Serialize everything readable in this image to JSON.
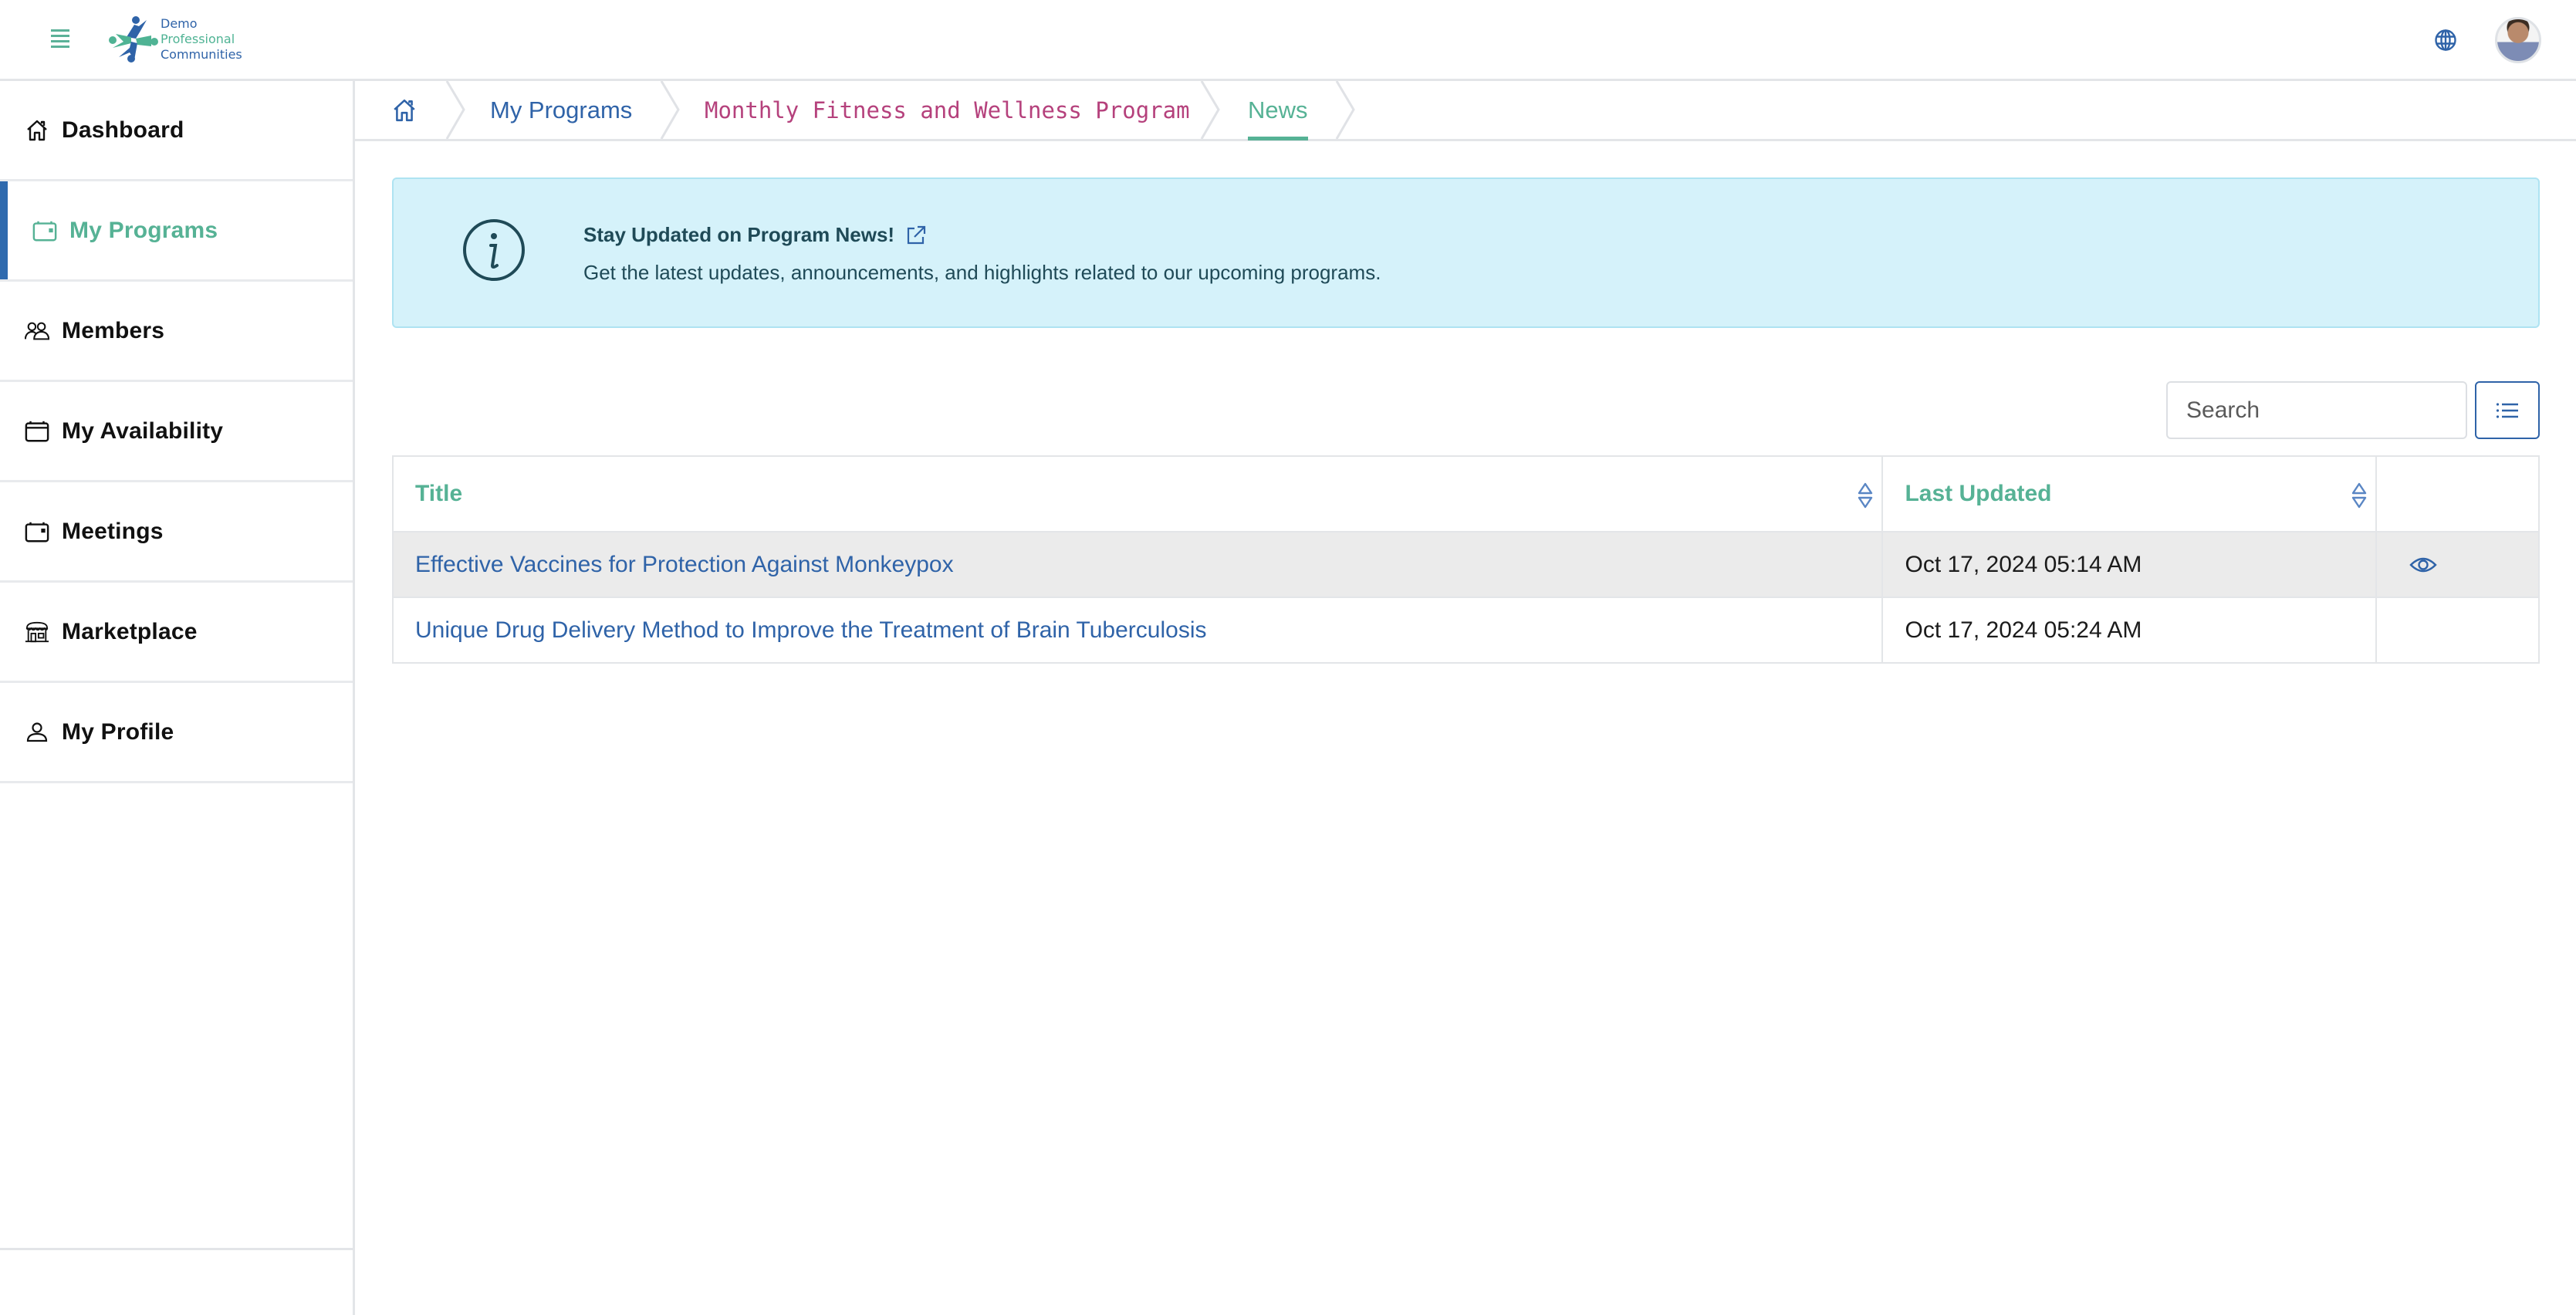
{
  "header": {
    "menu_icon": "hamburger-menu-icon",
    "logo": {
      "line1": "Demo",
      "line2": "Professional",
      "line3": "Communities"
    },
    "language_icon": "globe-icon",
    "avatar": "user-avatar"
  },
  "sidebar": {
    "active": "My Programs",
    "items": [
      {
        "label": "Dashboard",
        "icon": "home-icon"
      },
      {
        "label": "My Programs",
        "icon": "calendar-icon"
      },
      {
        "label": "Members",
        "icon": "members-icon"
      },
      {
        "label": "My Availability",
        "icon": "calendar-blank-icon"
      },
      {
        "label": "Meetings",
        "icon": "calendar-icon"
      },
      {
        "label": "Marketplace",
        "icon": "store-icon"
      },
      {
        "label": "My Profile",
        "icon": "user-icon"
      }
    ]
  },
  "breadcrumb": {
    "home_icon": "home-icon",
    "items": [
      {
        "label": "My Programs"
      },
      {
        "label": "Monthly Fitness and Wellness Program"
      },
      {
        "label": "News"
      }
    ],
    "collapse_icon": "chevron-left-icon"
  },
  "alert": {
    "title": "Stay Updated on Program News!",
    "body": "Get the latest updates, announcements, and highlights related to our upcoming programs.",
    "icon": "info-icon",
    "link_icon": "external-link-icon"
  },
  "toolbar": {
    "search_placeholder": "Search",
    "search_value": "",
    "view_toggle_icon": "list-icon"
  },
  "table": {
    "columns": [
      {
        "label": "Title",
        "sortable": true
      },
      {
        "label": "Last Updated",
        "sortable": true
      },
      {
        "label": "",
        "sortable": false
      }
    ],
    "rows": [
      {
        "title": "Effective Vaccines for Protection Against Monkeypox",
        "last_updated": "Oct 17, 2024 05:14 AM",
        "action_icon": "eye-icon",
        "highlighted": true
      },
      {
        "title": "Unique Drug Delivery Method to Improve the Treatment of Brain Tuberculosis",
        "last_updated": "Oct 17, 2024 05:24 AM",
        "action_icon": "",
        "highlighted": false
      }
    ]
  },
  "colors": {
    "brand_blue": "#2f63a8",
    "brand_green": "#56b295",
    "accent_pink": "#b5417c",
    "alert_bg": "#d5f2fa",
    "row_highlight": "#ebebeb"
  }
}
